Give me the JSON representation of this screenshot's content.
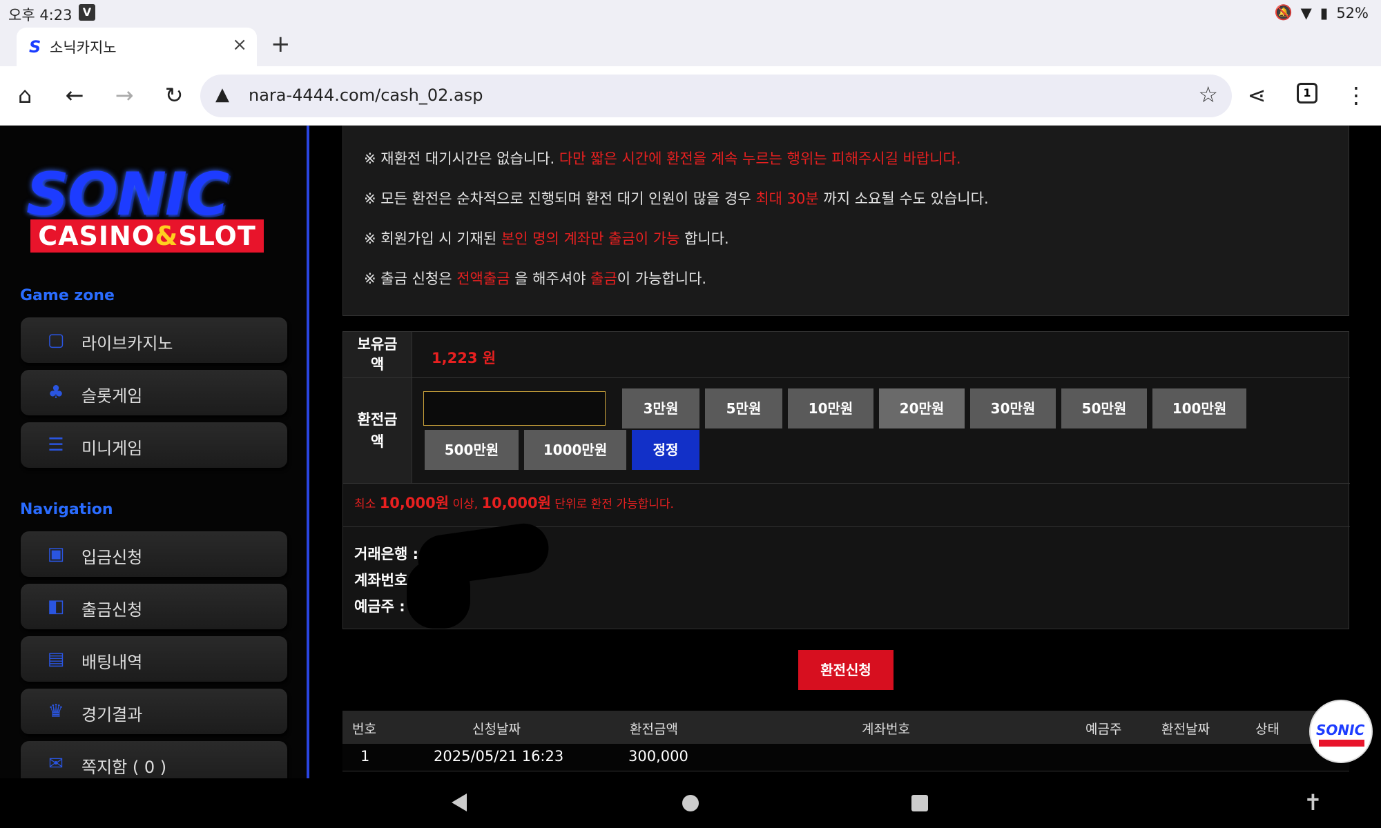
{
  "status": {
    "time": "오후 4:23",
    "battery": "52%",
    "app_icon": "V"
  },
  "browser": {
    "tab_title": "소닉카지노",
    "url": "nara-4444.com/cash_02.asp",
    "tab_count": "1"
  },
  "brand": {
    "logo_main": "SONIC",
    "logo_sub_a": "CASINO",
    "logo_sub_amp": "&",
    "logo_sub_b": "SLOT"
  },
  "sidebar": {
    "game_zone_title": "Game zone",
    "game_items": [
      {
        "label": "라이브카지노",
        "icon": "card-icon"
      },
      {
        "label": "슬롯게임",
        "icon": "slot-icon"
      },
      {
        "label": "미니게임",
        "icon": "mini-icon"
      }
    ],
    "navigation_title": "Navigation",
    "nav_items": [
      {
        "label": "입금신청",
        "icon": "deposit-icon"
      },
      {
        "label": "출금신청",
        "icon": "wallet-icon"
      },
      {
        "label": "배팅내역",
        "icon": "history-icon"
      },
      {
        "label": "경기결과",
        "icon": "trophy-icon"
      },
      {
        "label": "쪽지함 ( 0 )",
        "icon": "message-icon"
      }
    ]
  },
  "notice": {
    "line1_a": "※ 재환전 대기시간은 없습니다. ",
    "line1_b": "다만 짧은 시간에 환전을 계속 누르는 행위는 피해주시길 바랍니다.",
    "line2_a": "※ 모든 환전은 순차적으로 진행되며 환전 대기 인원이 많을 경우 ",
    "line2_b": "최대 30분",
    "line2_c": " 까지 소요될 수도 있습니다.",
    "line3_a": "※ 회원가입 시 기재된 ",
    "line3_b": "본인 명의 계좌만 출금이 가능",
    "line3_c": " 합니다.",
    "line4_a": "※ 출금 신청은 ",
    "line4_b": "전액출금",
    "line4_c": " 을 해주셔야 ",
    "line4_d": "출금",
    "line4_e": "이 가능합니다."
  },
  "form": {
    "balance_label_1": "보유금",
    "balance_label_2": "액",
    "balance_value": "1,223 원",
    "amount_label_1": "환전금",
    "amount_label_2": "액",
    "amount_value": "",
    "quick_buttons": [
      "3만원",
      "5만원",
      "10만원",
      "20만원",
      "30만원",
      "50만원",
      "100만원",
      "500만원",
      "1000만원"
    ],
    "reset_button": "정정",
    "min_rule_a": "최소 ",
    "min_rule_b": "10,000원",
    "min_rule_c": " 이상, ",
    "min_rule_d": "10,000원",
    "min_rule_e": "  단위로 환전 가능합니다.",
    "bank_label": "거래은행 :",
    "account_label": "계좌번호 :",
    "holder_label": "예금주 :",
    "submit_button": "환전신청"
  },
  "history": {
    "headers": [
      "번호",
      "신청날짜",
      "환전금액",
      "계좌번호",
      "예금주",
      "환전날짜",
      "상태"
    ],
    "rows": [
      {
        "no": "1",
        "date": "2025/05/21 16:23",
        "amount": "300,000"
      }
    ]
  }
}
